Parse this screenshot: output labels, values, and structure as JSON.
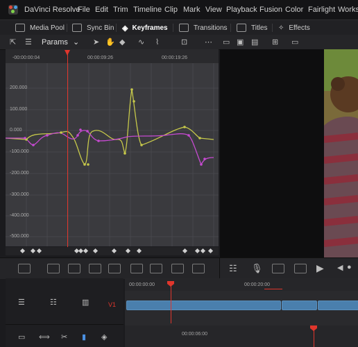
{
  "menubar": {
    "items": [
      "DaVinci Resolve",
      "File",
      "Edit",
      "Trim",
      "Timeline",
      "Clip",
      "Mark",
      "View",
      "Playback",
      "Fusion",
      "Color",
      "Fairlight",
      "Works"
    ]
  },
  "toolbar": {
    "media_pool": "Media Pool",
    "sync_bin": "Sync Bin",
    "keyframes": "Keyframes",
    "transitions": "Transitions",
    "titles": "Titles",
    "effects": "Effects"
  },
  "subtool": {
    "params": "Params"
  },
  "ruler": {
    "t0": "-00:00:00:04",
    "t1": "00:00:09:26",
    "t2": "00:00:19:26"
  },
  "graph": {
    "yticks": [
      "200.000",
      "100.000",
      "0.000",
      "-100.000",
      "-200.000",
      "-300.000",
      "-400.000",
      "-500.000"
    ]
  },
  "timeline": {
    "track_label": "V1",
    "head_t0": "00:00:00:00",
    "head_t1": "00:00:20:00",
    "head2_t0": "00:00:06:00"
  },
  "colors": {
    "playhead": "#e0362c",
    "curve_yellow": "#c6c84a",
    "curve_magenta": "#c64ad1",
    "clip": "#4a7fad"
  }
}
